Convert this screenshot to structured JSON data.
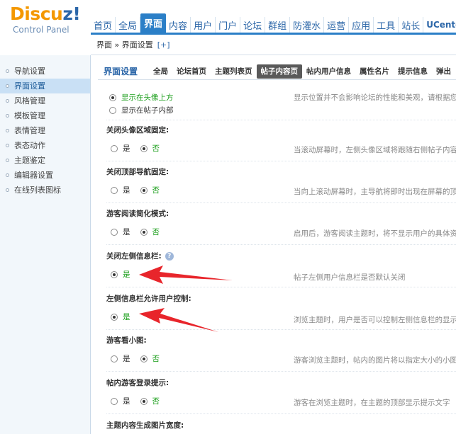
{
  "logo": {
    "main_prefix": "Discu",
    "main_suffix": "z!",
    "sub": "Control Panel"
  },
  "topnav": [
    "首页",
    "全局",
    "界面",
    "内容",
    "用户",
    "门户",
    "论坛",
    "群组",
    "防灌水",
    "运营",
    "应用",
    "工具",
    "站长",
    "UCenter"
  ],
  "breadcrumb": {
    "path": "界面 » 界面设置",
    "add": "[+]"
  },
  "sidebar": [
    "导航设置",
    "界面设置",
    "风格管理",
    "模板管理",
    "表情管理",
    "表态动作",
    "主题鉴定",
    "编辑器设置",
    "在线列表图标"
  ],
  "main": {
    "section_title": "界面设置",
    "tabs": [
      "全局",
      "论坛首页",
      "主题列表页",
      "帖子内容页",
      "帖内用户信息",
      "属性名片",
      "提示信息",
      "弹出"
    ],
    "avatar_pos": {
      "opt1": "显示在头像上方",
      "opt2": "显示在帖子内部",
      "desc": "显示位置并不会影响论坛的性能和美观，请根据您会"
    },
    "rows": [
      {
        "label": "关闭头像区域固定:",
        "yes": "是",
        "no": "否",
        "desc": "当滚动屏幕时，左侧头像区域将跟随右侧帖子内容滚"
      },
      {
        "label": "关闭顶部导航固定:",
        "yes": "是",
        "no": "否",
        "desc": "当向上滚动屏幕时，主导航将即时出现在屏幕的顶部"
      },
      {
        "label": "游客阅读简化模式:",
        "yes": "是",
        "no": "否",
        "desc": "启用后，游客阅读主题时，将不显示用户的具体资料"
      },
      {
        "label": "关闭左侧信息栏:",
        "yes": "是",
        "no": "否",
        "desc": "帖子左侧用户信息栏是否默认关闭"
      },
      {
        "label": "左侧信息栏允许用户控制:",
        "yes": "是",
        "no": "否",
        "desc": "浏览主题时，用户是否可以控制左侧信息栏的显示状"
      },
      {
        "label": "游客看小图:",
        "yes": "是",
        "no": "否",
        "desc": "游客浏览主题时，帖内的图片将以指定大小的小图显"
      },
      {
        "label": "帖内游客登录提示:",
        "yes": "是",
        "no": "否",
        "desc": "游客在浏览主题时，在主题的顶部显示提示文字"
      },
      {
        "label": "主题内容生成图片宽度:"
      }
    ],
    "help": "?"
  },
  "colors": {
    "accent": "#2b7fc7",
    "logo_orange": "#f49800",
    "arrow": "#e8252b",
    "checked_green": "#1a9e1a"
  }
}
